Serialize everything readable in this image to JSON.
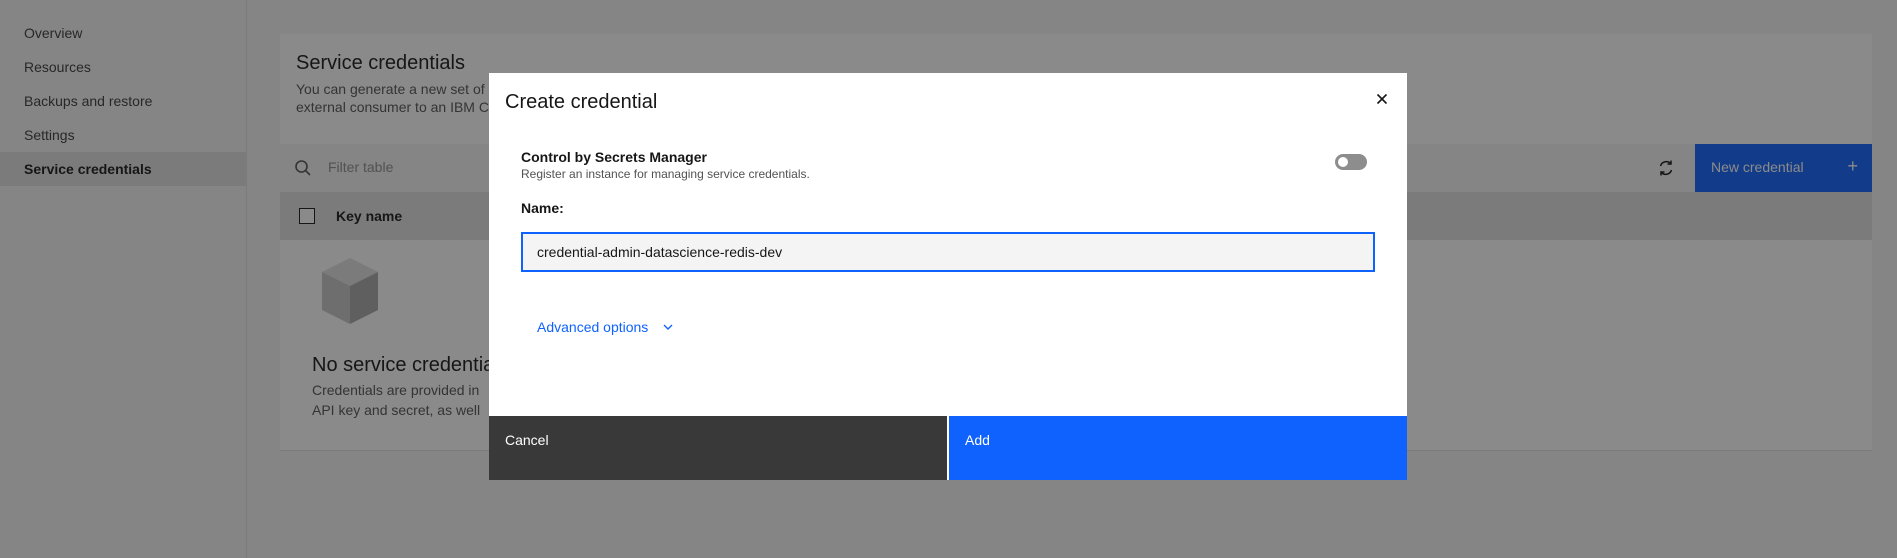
{
  "sidebar": {
    "items": [
      {
        "label": "Overview"
      },
      {
        "label": "Resources"
      },
      {
        "label": "Backups and restore"
      },
      {
        "label": "Settings"
      },
      {
        "label": "Service credentials",
        "active": true
      }
    ]
  },
  "main": {
    "title": "Service credentials",
    "description_visible": "You can generate a new set of",
    "description_visible_line2": "external consumer to an IBM C",
    "filter_placeholder": "Filter table",
    "new_button_label": "New credential",
    "table_header": "Key name",
    "empty_title": "No service credentia",
    "empty_desc_line1": "Credentials are provided in",
    "empty_desc_line2": "API key and secret, as well"
  },
  "modal": {
    "title": "Create credential",
    "toggle_label": "Control by Secrets Manager",
    "toggle_desc": "Register an instance for managing service credentials.",
    "toggle_on": false,
    "name_label": "Name:",
    "name_value": "credential-admin-datascience-redis-dev",
    "advanced_label": "Advanced options",
    "cancel_label": "Cancel",
    "add_label": "Add"
  },
  "colors": {
    "primary": "#0f62fe",
    "secondary": "#393939"
  }
}
